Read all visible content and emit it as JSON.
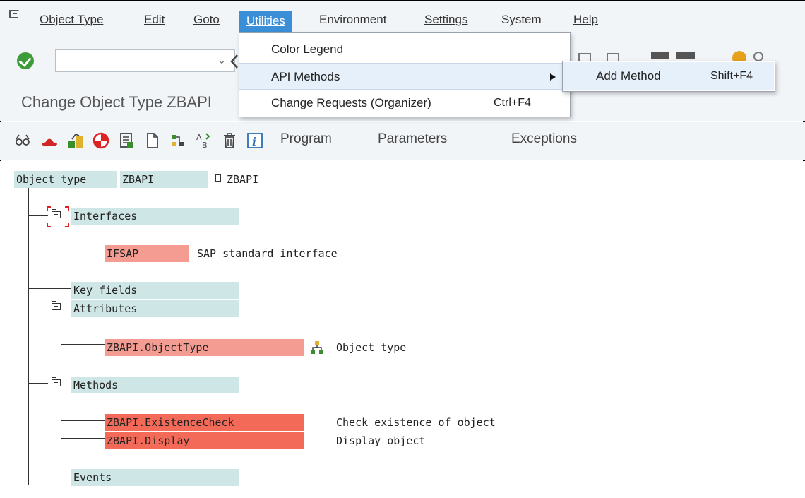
{
  "menubar": {
    "items": [
      "Object Type",
      "Edit",
      "Goto",
      "Utilities",
      "Environment",
      "Settings",
      "System",
      "Help"
    ]
  },
  "toolbar": {
    "command_value": "",
    "dropdown_glyph": "⌄"
  },
  "title": "Change Object Type ZBAPI",
  "app_toolbar": {
    "buttons": [
      "Program",
      "Parameters",
      "Exceptions"
    ]
  },
  "utilities_menu": {
    "items": [
      {
        "label": "Color Legend",
        "shortcut": ""
      },
      {
        "label": "API Methods",
        "shortcut": ""
      },
      {
        "label": "Change Requests (Organizer)",
        "shortcut": "Ctrl+F4"
      }
    ],
    "submenu": {
      "label": "Add Method",
      "shortcut": "Shift+F4"
    }
  },
  "tree": {
    "root_label": "Object type",
    "root_value": "ZBAPI",
    "root_desc": "ZBAPI",
    "interfaces": "Interfaces",
    "ifsap": "IFSAP",
    "ifsap_desc": "SAP standard interface",
    "key_fields": "Key fields",
    "attributes": "Attributes",
    "attr_objecttype": "ZBAPI.ObjectType",
    "attr_objecttype_desc": "Object type",
    "methods": "Methods",
    "method_existence": "ZBAPI.ExistenceCheck",
    "method_existence_desc": "Check existence of object",
    "method_display": "ZBAPI.Display",
    "method_display_desc": "Display object",
    "events": "Events"
  },
  "colors": {
    "menu_active": "#3a8fd6",
    "cell_cyan": "#cfe6e6",
    "cell_salmon": "#f49c92",
    "cell_red": "#f36a58",
    "ok_green": "#3e9b3a",
    "header_bg": "#f2f5f8"
  }
}
